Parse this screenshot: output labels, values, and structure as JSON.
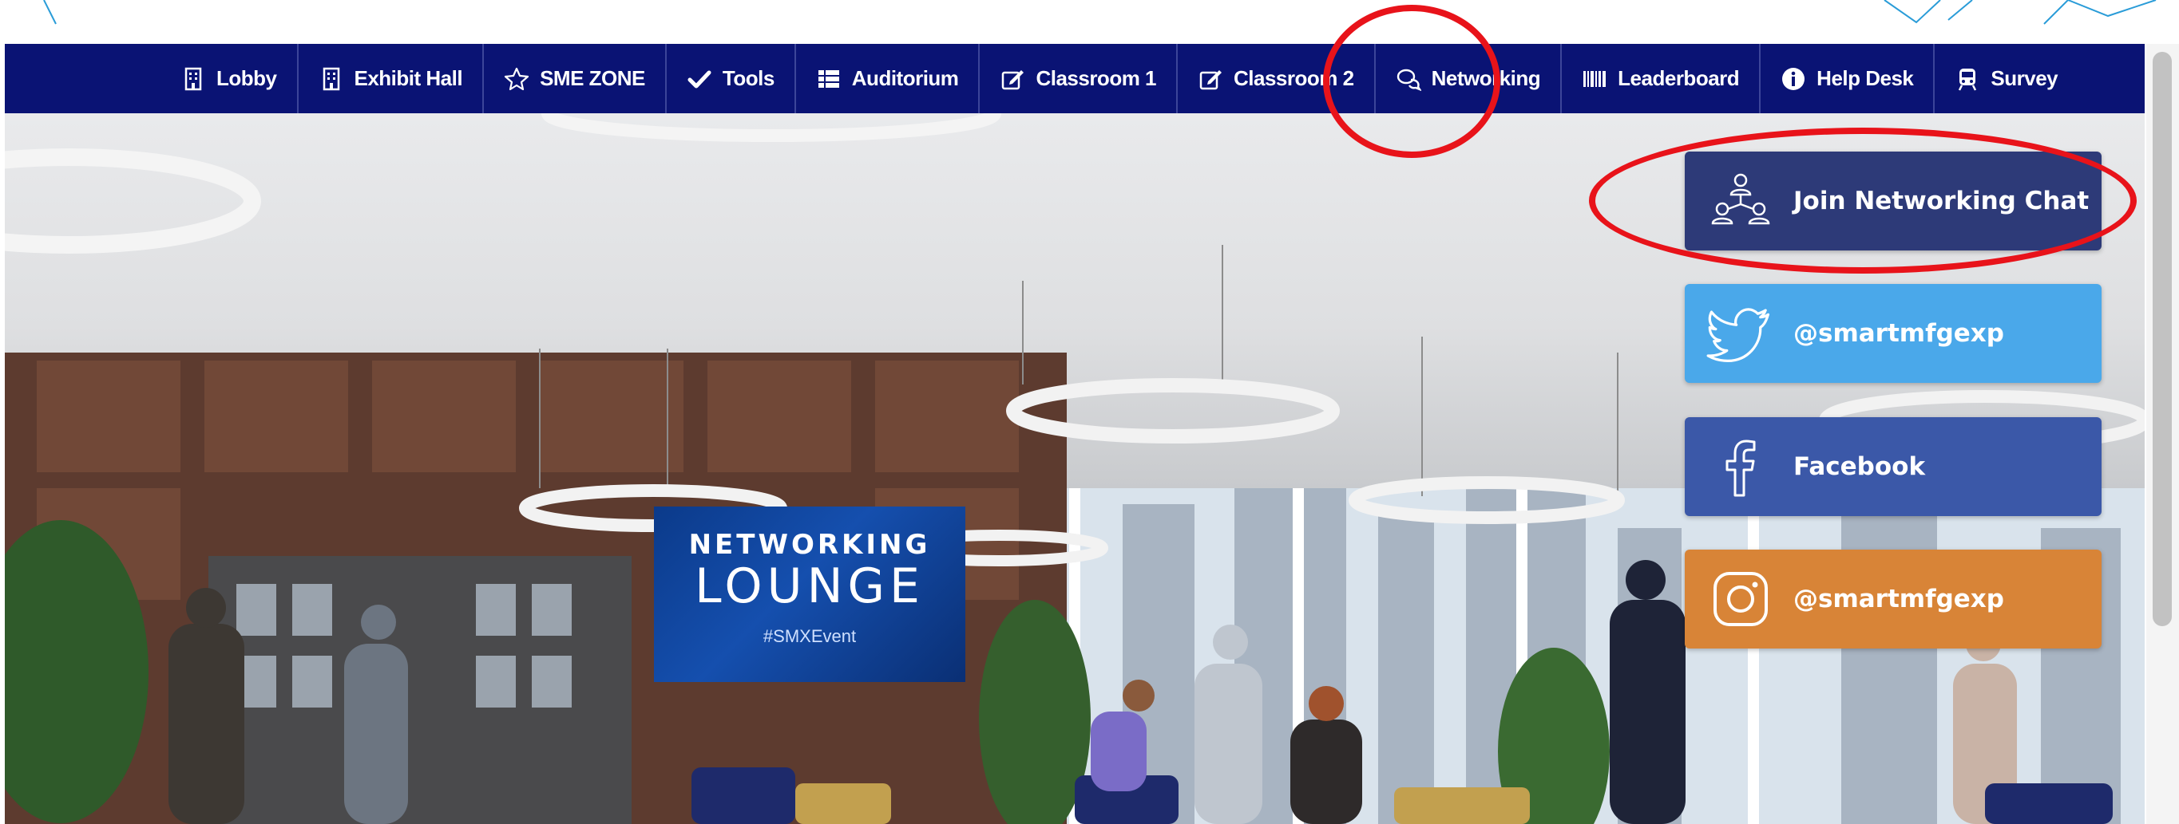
{
  "nav": {
    "items": [
      {
        "label": "Lobby",
        "icon": "building-icon"
      },
      {
        "label": "Exhibit Hall",
        "icon": "building-icon"
      },
      {
        "label": "SME ZONE",
        "icon": "star-icon"
      },
      {
        "label": "Tools",
        "icon": "check-icon"
      },
      {
        "label": "Auditorium",
        "icon": "list-icon"
      },
      {
        "label": "Classroom 1",
        "icon": "edit-icon"
      },
      {
        "label": "Classroom 2",
        "icon": "edit-icon"
      },
      {
        "label": "Networking",
        "icon": "chat-icon"
      },
      {
        "label": "Leaderboard",
        "icon": "barcode-icon"
      },
      {
        "label": "Help Desk",
        "icon": "info-icon"
      },
      {
        "label": "Survey",
        "icon": "train-icon"
      }
    ]
  },
  "scene": {
    "sign": {
      "line1": "NETWORKING",
      "line2": "LOUNGE",
      "tag": "#SMXEvent"
    }
  },
  "side_buttons": {
    "join": {
      "label": "Join Networking Chat",
      "icon": "network-users-icon"
    },
    "twitter": {
      "label": "@smartmfgexp",
      "icon": "twitter-icon"
    },
    "facebook": {
      "label": "Facebook",
      "icon": "facebook-icon"
    },
    "instagram": {
      "label": "@smartmfgexp",
      "icon": "instagram-icon"
    }
  },
  "colors": {
    "nav_bg": "#0a1374",
    "join_bg": "#2d3a78",
    "twitter_bg": "#4aa8ea",
    "facebook_bg": "#3b58a8",
    "instagram_bg": "#d88437",
    "annotation": "#e8131a"
  }
}
